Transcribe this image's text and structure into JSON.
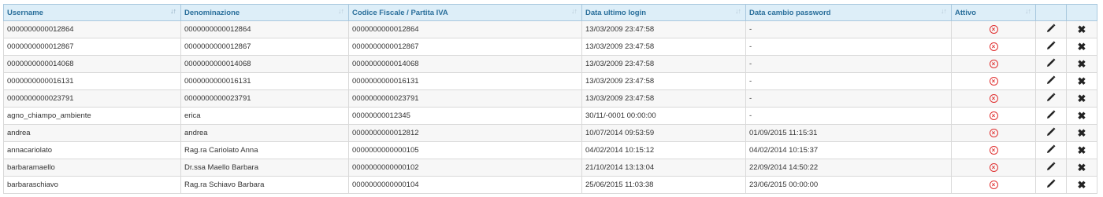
{
  "columns": [
    {
      "label": "Username",
      "sorted": true
    },
    {
      "label": "Denominazione",
      "sorted": false
    },
    {
      "label": "Codice Fiscale / Partita IVA",
      "sorted": false
    },
    {
      "label": "Data ultimo login",
      "sorted": false
    },
    {
      "label": "Data cambio password",
      "sorted": false
    },
    {
      "label": "Attivo",
      "sorted": false
    }
  ],
  "sort_glyph": "↓↑",
  "status_glyph": "×",
  "delete_glyph": "✖",
  "colors": {
    "header_bg": "#ddeef8",
    "header_text": "#2a6f9b",
    "inactive_red": "#e03131"
  },
  "rows": [
    {
      "username": "0000000000012864",
      "denominazione": "0000000000012864",
      "codice": "0000000000012864",
      "ultimo_login": "13/03/2009 23:47:58",
      "cambio_password": "-",
      "attivo": false
    },
    {
      "username": "0000000000012867",
      "denominazione": "0000000000012867",
      "codice": "0000000000012867",
      "ultimo_login": "13/03/2009 23:47:58",
      "cambio_password": "-",
      "attivo": false
    },
    {
      "username": "0000000000014068",
      "denominazione": "0000000000014068",
      "codice": "0000000000014068",
      "ultimo_login": "13/03/2009 23:47:58",
      "cambio_password": "-",
      "attivo": false
    },
    {
      "username": "0000000000016131",
      "denominazione": "0000000000016131",
      "codice": "0000000000016131",
      "ultimo_login": "13/03/2009 23:47:58",
      "cambio_password": "-",
      "attivo": false
    },
    {
      "username": "0000000000023791",
      "denominazione": "0000000000023791",
      "codice": "0000000000023791",
      "ultimo_login": "13/03/2009 23:47:58",
      "cambio_password": "-",
      "attivo": false
    },
    {
      "username": "agno_chiampo_ambiente",
      "denominazione": "erica",
      "codice": "00000000012345",
      "ultimo_login": "30/11/-0001 00:00:00",
      "cambio_password": "-",
      "attivo": false
    },
    {
      "username": "andrea",
      "denominazione": "andrea",
      "codice": "0000000000012812",
      "ultimo_login": "10/07/2014 09:53:59",
      "cambio_password": "01/09/2015 11:15:31",
      "attivo": false
    },
    {
      "username": "annacariolato",
      "denominazione": "Rag.ra Cariolato Anna",
      "codice": "0000000000000105",
      "ultimo_login": "04/02/2014 10:15:12",
      "cambio_password": "04/02/2014 10:15:37",
      "attivo": false
    },
    {
      "username": "barbaramaello",
      "denominazione": "Dr.ssa Maello Barbara",
      "codice": "0000000000000102",
      "ultimo_login": "21/10/2014 13:13:04",
      "cambio_password": "22/09/2014 14:50:22",
      "attivo": false
    },
    {
      "username": "barbaraschiavo",
      "denominazione": "Rag.ra Schiavo Barbara",
      "codice": "0000000000000104",
      "ultimo_login": "25/06/2015 11:03:38",
      "cambio_password": "23/06/2015 00:00:00",
      "attivo": false
    }
  ]
}
